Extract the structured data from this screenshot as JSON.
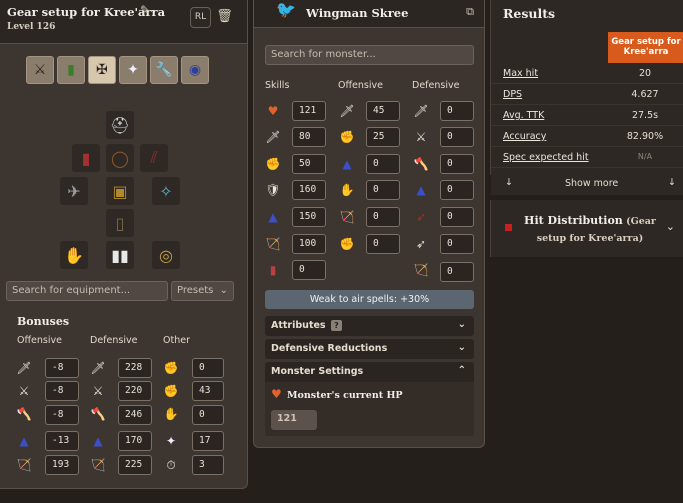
{
  "left": {
    "title": "Gear setup for Kree'arra",
    "level": "Level 126",
    "rl_label": "RL",
    "equipment_search_placeholder": "Search for equipment...",
    "presets_label": "Presets",
    "bonuses_title": "Bonuses",
    "col_offensive": "Offensive",
    "col_defensive": "Defensive",
    "col_other": "Other",
    "offensive": [
      "-8",
      "-8",
      "-8",
      "-13",
      "193"
    ],
    "defensive": [
      "228",
      "220",
      "246",
      "170",
      "225"
    ],
    "other": [
      "0",
      "43",
      "0",
      "17",
      "3"
    ]
  },
  "mid": {
    "monster_name": "Wingman Skree",
    "monster_search_placeholder": "Search for monster...",
    "col_skills": "Skills",
    "col_offensive": "Offensive",
    "col_defensive": "Defensive",
    "skills": [
      "121",
      "80",
      "50",
      "160",
      "150",
      "100",
      "0"
    ],
    "offensive": [
      "45",
      "25",
      "0",
      "0",
      "0",
      "0"
    ],
    "defensive": [
      "0",
      "0",
      "0",
      "0",
      "0",
      "0",
      "0"
    ],
    "weakness": "Weak to air spells: +30%",
    "attributes_label": "Attributes",
    "attributes_help": "?",
    "defensive_reductions_label": "Defensive Reductions",
    "monster_settings_label": "Monster Settings",
    "current_hp_label": "Monster's current HP",
    "current_hp_value": "121"
  },
  "right": {
    "results_title": "Results",
    "setup_header": "Gear setup for Kree'arra",
    "rows": [
      {
        "label": "Max hit",
        "value": "20"
      },
      {
        "label": "DPS",
        "value": "4.627"
      },
      {
        "label": "Avg. TTK",
        "value": "27.5s"
      },
      {
        "label": "Accuracy",
        "value": "82.90%"
      },
      {
        "label": "Spec expected hit",
        "value": "N/A"
      }
    ],
    "show_more": "Show more",
    "hit_dist_title": "Hit Distribution",
    "hit_dist_sub": "(Gear setup for Kree'arra)"
  },
  "colors": {
    "accent": "#d85a1c",
    "panel": "#3d3630",
    "background": "#241f1b"
  }
}
